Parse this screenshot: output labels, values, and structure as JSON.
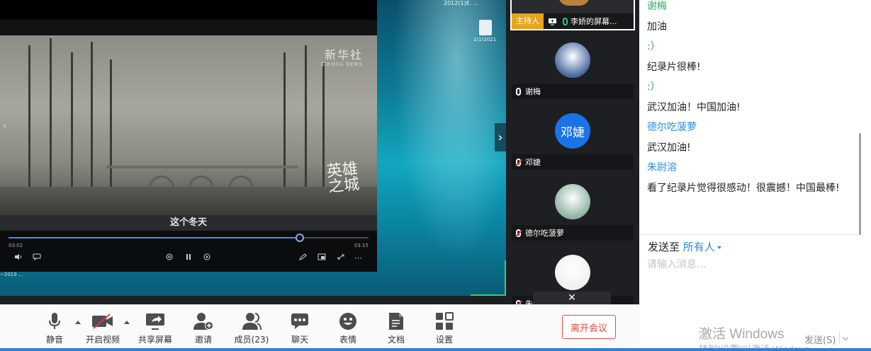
{
  "desktop": {
    "clock": "2012(1)E. ...",
    "file_label": "1(1)2021",
    "footer_text": "~2019 ..."
  },
  "player": {
    "watermark": "新华社",
    "watermark_sub": "XINHUA NEWS",
    "calligraphy": "英雄之城",
    "subtitle": "这个冬天",
    "time_current": "03:02",
    "time_total": "03:15",
    "progress": 0.81,
    "icons": [
      "volume-icon",
      "danmaku-icon",
      "prev-icon",
      "pause-icon",
      "next-icon",
      "pen-icon",
      "pip-icon",
      "fullscreen-icon",
      "more-icon"
    ]
  },
  "participants": {
    "host": {
      "badge": "主持人",
      "name": "李娇的屏幕..."
    },
    "members": [
      {
        "name": "谢梅",
        "avatar_type": "photo",
        "avatar_color": "#4a6aa0",
        "mic": "on"
      },
      {
        "name": "邓婕",
        "avatar_type": "text",
        "avatar_text": "邓婕",
        "avatar_color": "#1a73e8",
        "mic": "off"
      },
      {
        "name": "德尔吃菠萝",
        "avatar_type": "photo",
        "avatar_color": "#8fb5a4",
        "mic": "off"
      },
      {
        "name": "朱尉溶",
        "avatar_type": "photo",
        "avatar_color": "#f0f0f0",
        "mic": "off"
      }
    ],
    "tooltip_close": "✕"
  },
  "chat": {
    "messages": [
      {
        "sender": "谢梅",
        "sender_color": "green",
        "text": "加油"
      },
      {
        "sender": ":）",
        "sender_color": "blue",
        "text": "纪录片很棒!"
      },
      {
        "sender": ":）",
        "sender_color": "blue",
        "text": "武汉加油！中国加油!"
      },
      {
        "sender": "德尔吃菠萝",
        "sender_color": "blue",
        "text": "武汉加油!"
      },
      {
        "sender": "朱尉溶",
        "sender_color": "blue",
        "text": "看了纪录片觉得很感动！很震撼！中国最棒!"
      }
    ],
    "send_to_label": "发送至",
    "send_to_target": "所有人",
    "input_placeholder": "请输入消息...",
    "send_button": "发送(S)",
    "windows_watermark": "激活 Windows",
    "windows_watermark_sub": "转到\"设置\"以激活 Windows。"
  },
  "toolbar": {
    "items": [
      {
        "label": "静音",
        "icon": "mic-icon"
      },
      {
        "label": "开启视频",
        "icon": "camera-off-icon"
      },
      {
        "label": "共享屏幕",
        "icon": "share-screen-icon"
      },
      {
        "label": "邀请",
        "icon": "invite-icon"
      },
      {
        "label": "成员(23)",
        "icon": "members-icon"
      },
      {
        "label": "聊天",
        "icon": "chat-icon"
      },
      {
        "label": "表情",
        "icon": "emoji-icon"
      },
      {
        "label": "文档",
        "icon": "document-icon"
      },
      {
        "label": "设置",
        "icon": "settings-icon"
      }
    ],
    "leave_button": "离开会议"
  },
  "colors": {
    "accent": "#2a8cdc",
    "host_badge": "#e8a51d",
    "leave": "#e44a4a",
    "green": "#27b264"
  }
}
